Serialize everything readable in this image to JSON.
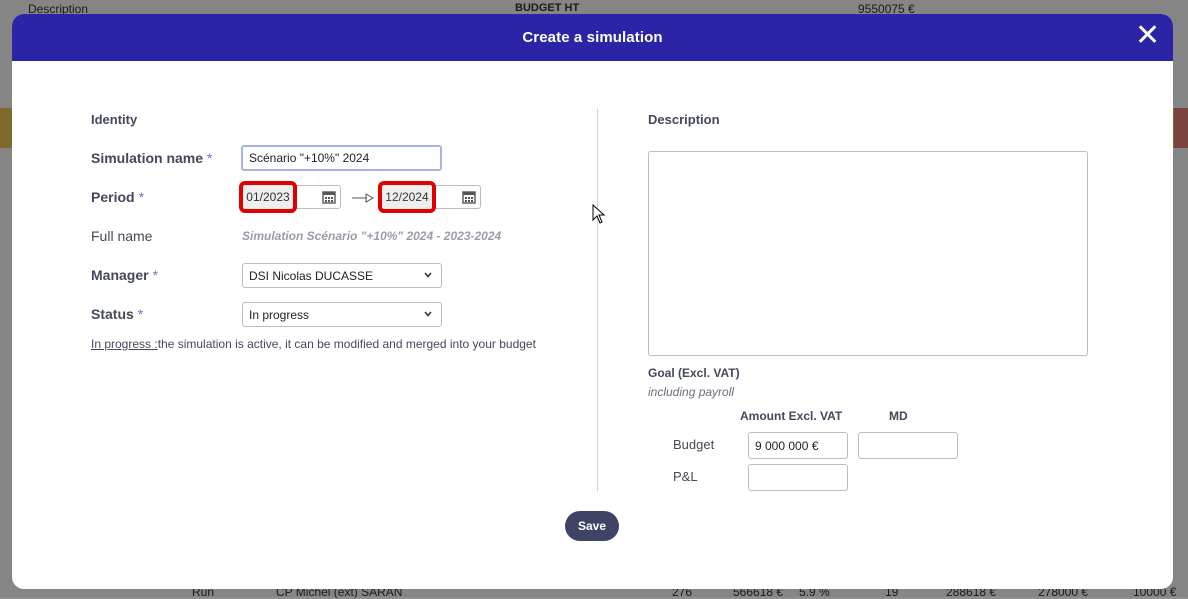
{
  "background": {
    "top_description": "Description",
    "top_budget": "BUDGET HT",
    "top_amount": "9550075 €",
    "bottom_run": "Run",
    "bottom_manager": "CP Michel (ext) SARAN",
    "bottom_cols": [
      "276",
      "566618 €",
      "5.9 %",
      "19",
      "288618 €",
      "278000 €",
      "10000 €"
    ]
  },
  "modal": {
    "title": "Create a simulation",
    "close_icon": "close-icon",
    "identity": {
      "section_title": "Identity",
      "simulation_name_label": "Simulation name",
      "simulation_name_value": "Scénario \"+10%\" 2024",
      "period_label": "Period",
      "period_start": "01/2023",
      "period_end": "12/2024",
      "period_arrow": "→",
      "full_name_label": "Full name",
      "full_name_value": "Simulation Scénario \"+10%\" 2024 - 2023-2024",
      "manager_label": "Manager",
      "manager_value": "DSI Nicolas DUCASSE",
      "status_label": "Status",
      "status_value": "In progress",
      "status_help_term": "In progress :",
      "status_help_text": "the simulation is active, it can be modified and merged into your budget",
      "required_mark": "*"
    },
    "description": {
      "section_title": "Description",
      "value": ""
    },
    "goal": {
      "title": "Goal (Excl. VAT)",
      "subtitle": "including payroll",
      "col_amount": "Amount Excl. VAT",
      "col_md": "MD",
      "budget_label": "Budget",
      "budget_amount": "9 000 000 €",
      "budget_md": "",
      "pl_label": "P&L",
      "pl_amount": ""
    },
    "save_label": "Save"
  },
  "colors": {
    "header": "#2b24a6",
    "highlight": "#e10000",
    "save_button": "#3f4466"
  }
}
